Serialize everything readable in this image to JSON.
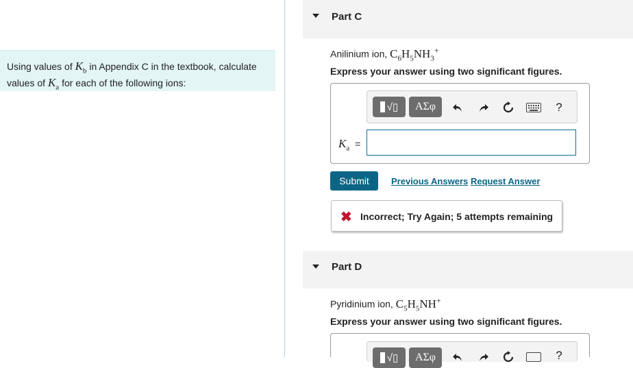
{
  "intro": {
    "prefix": "Using values of",
    "kb_symbol": "K",
    "kb_sub": "b",
    "middle": "in Appendix C in the textbook, calculate values of",
    "ka_symbol": "K",
    "ka_sub": "a",
    "suffix": "for each of the following ions:"
  },
  "partC": {
    "title": "Part C",
    "ion_label": "Anilinium ion,",
    "formula": {
      "c": "C",
      "c_sub": "6",
      "h": "H",
      "h_sub": "5",
      "nh": "NH",
      "nh_sub": "3",
      "charge": "+"
    },
    "instruction": "Express your answer using two significant figures.",
    "answer_label_symbol": "K",
    "answer_label_sub": "a",
    "answer_equals": "=",
    "answer_value": ""
  },
  "toolbar": {
    "templates_label": "√▯",
    "greek_label": "ΑΣφ",
    "undo_icon": "undo-icon",
    "redo_icon": "redo-icon",
    "reset_icon": "reset-icon",
    "keyboard_icon": "keyboard-icon",
    "help_label": "?"
  },
  "actions": {
    "submit": "Submit",
    "previous_answers": "Previous Answers",
    "request_answer": "Request Answer"
  },
  "feedback": {
    "icon": "✖",
    "text": "Incorrect; Try Again; 5 attempts remaining"
  },
  "partD": {
    "title": "Part D",
    "ion_label": "Pyridinium ion,",
    "formula": {
      "c": "C",
      "c_sub": "5",
      "h": "H",
      "h_sub": "5",
      "nh": "NH",
      "charge": "+"
    },
    "instruction": "Express your answer using two significant figures."
  },
  "colors": {
    "intro_bg": "#e3f5f5",
    "submit_bg": "#0d6585",
    "link": "#0d6585",
    "error": "#c0152f",
    "input_border": "#0d6b94"
  }
}
